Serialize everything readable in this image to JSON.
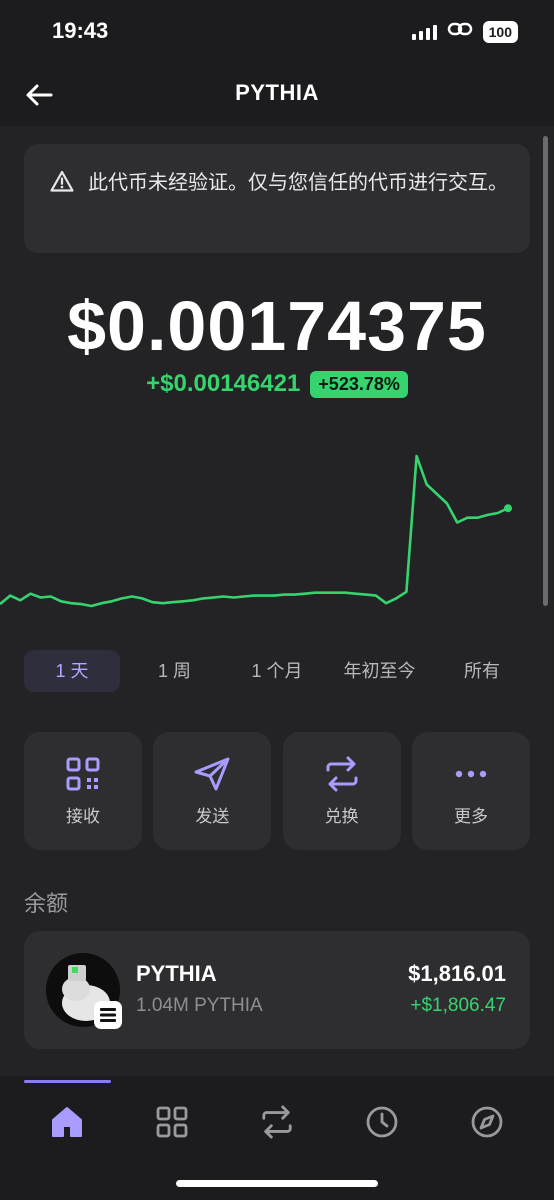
{
  "status": {
    "time": "19:43",
    "battery": "100"
  },
  "nav": {
    "title": "PYTHIA",
    "back_icon": "arrow-left-icon"
  },
  "warning": {
    "icon": "warning-triangle-icon",
    "text": "此代币未经验证。仅与您信任的代币进行交互。"
  },
  "price": {
    "value": "$0.00174375",
    "change_value": "+$0.00146421",
    "change_percent": "+523.78%"
  },
  "chart_data": {
    "type": "line",
    "color": "#35d46f",
    "x": [
      0,
      1,
      2,
      3,
      4,
      5,
      6,
      7,
      8,
      9,
      10,
      11,
      12,
      13,
      14,
      15,
      16,
      17,
      18,
      19,
      20,
      21,
      22,
      23,
      24,
      25,
      26,
      27,
      28,
      29,
      30,
      31,
      32,
      33,
      34,
      35,
      36,
      37,
      38,
      39,
      40,
      41,
      42,
      43,
      44,
      45,
      46,
      47,
      48,
      49,
      50
    ],
    "values": [
      0.00024,
      0.00033,
      0.00028,
      0.00035,
      0.00031,
      0.00032,
      0.00027,
      0.00025,
      0.00024,
      0.00022,
      0.00025,
      0.00027,
      0.0003,
      0.00032,
      0.0003,
      0.00026,
      0.00025,
      0.00026,
      0.00027,
      0.00028,
      0.0003,
      0.00031,
      0.00032,
      0.00031,
      0.00032,
      0.00033,
      0.00033,
      0.00033,
      0.00034,
      0.00034,
      0.00035,
      0.00036,
      0.00036,
      0.00036,
      0.00036,
      0.00035,
      0.00034,
      0.00033,
      0.00025,
      0.0003,
      0.00037,
      0.0018,
      0.0015,
      0.0014,
      0.0013,
      0.0011,
      0.00115,
      0.00115,
      0.00118,
      0.0012,
      0.00125
    ],
    "grid": false,
    "legend": "none"
  },
  "ranges": [
    {
      "label": "1 天",
      "active": true
    },
    {
      "label": "1 周",
      "active": false
    },
    {
      "label": "1 个月",
      "active": false
    },
    {
      "label": "年初至今",
      "active": false
    },
    {
      "label": "所有",
      "active": false
    }
  ],
  "actions": [
    {
      "label": "接收",
      "icon": "qr-code-icon"
    },
    {
      "label": "发送",
      "icon": "send-icon"
    },
    {
      "label": "兑换",
      "icon": "swap-icon"
    },
    {
      "label": "更多",
      "icon": "more-icon"
    }
  ],
  "balance": {
    "heading": "余额",
    "token": {
      "name": "PYTHIA",
      "amount": "1.04M PYTHIA",
      "value": "$1,816.01",
      "change": "+$1,806.47"
    }
  },
  "tabs": [
    "home-icon",
    "grid-icon",
    "swap-icon",
    "history-icon",
    "compass-icon"
  ],
  "colors": {
    "accent": "#8b7cf6",
    "positive": "#35d46f",
    "background": "#1c1c1e",
    "card": "#2e2e31"
  }
}
